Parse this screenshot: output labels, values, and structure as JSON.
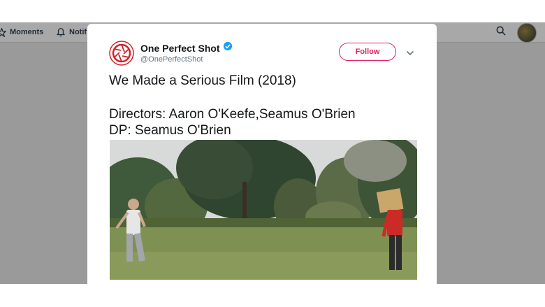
{
  "nav": {
    "moments_label": "Moments",
    "notifications_label": "Notif"
  },
  "tweet": {
    "display_name": "One Perfect Shot",
    "handle": "@OnePerfectShot",
    "follow_label": "Follow",
    "verified": true,
    "text_line1": "We Made a Serious Film (2018)",
    "text_line2": "Directors: Aaron O'Keefe,Seamus O'Brien",
    "text_line3": "DP: Seamus O'Brien"
  },
  "colors": {
    "accent": "#e0245e",
    "verified_blue": "#1da1f2",
    "backdrop": "#9a9a9a"
  },
  "icons": [
    "moments-icon",
    "bell-icon",
    "search-icon",
    "verified-badge-icon",
    "chevron-down-icon",
    "aperture-logo-icon"
  ]
}
